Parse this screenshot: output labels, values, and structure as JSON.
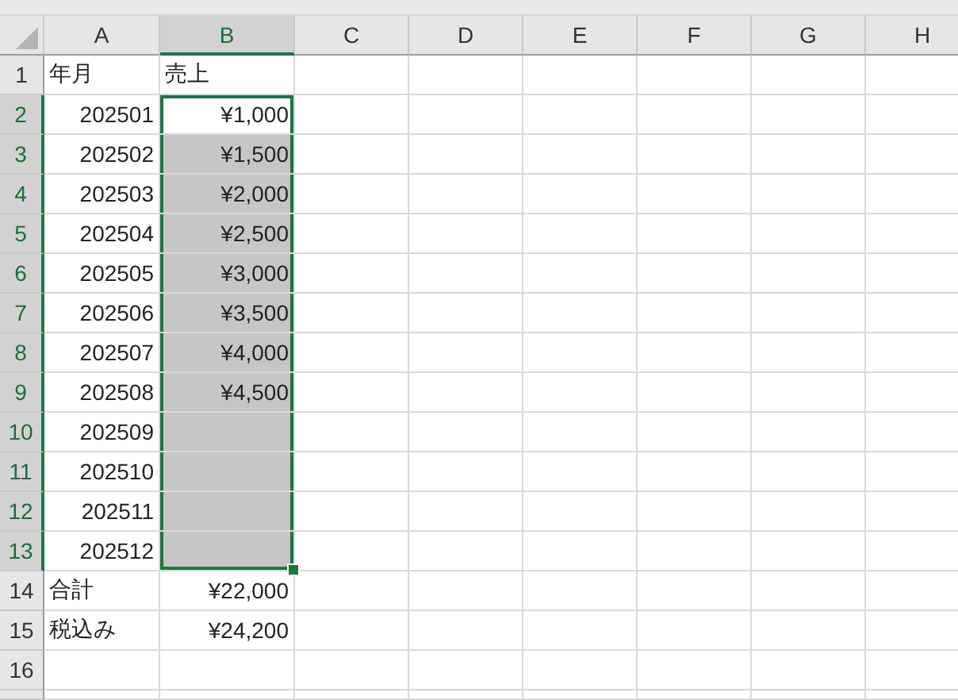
{
  "columns": [
    {
      "label": "A",
      "selected": false
    },
    {
      "label": "B",
      "selected": true
    },
    {
      "label": "C",
      "selected": false
    },
    {
      "label": "D",
      "selected": false
    },
    {
      "label": "E",
      "selected": false
    },
    {
      "label": "F",
      "selected": false
    },
    {
      "label": "G",
      "selected": false
    },
    {
      "label": "H",
      "selected": false
    }
  ],
  "rows": [
    {
      "label": "1",
      "selected": false,
      "cells": [
        {
          "text": "年月",
          "kind": "text",
          "active": false,
          "highlighted": false
        },
        {
          "text": "売上",
          "kind": "text",
          "active": false,
          "highlighted": false
        }
      ]
    },
    {
      "label": "2",
      "selected": true,
      "cells": [
        {
          "text": "202501",
          "kind": "number",
          "active": false,
          "highlighted": false
        },
        {
          "text": "¥1,000",
          "kind": "number",
          "active": true,
          "highlighted": false
        }
      ]
    },
    {
      "label": "3",
      "selected": true,
      "cells": [
        {
          "text": "202502",
          "kind": "number",
          "active": false,
          "highlighted": false
        },
        {
          "text": "¥1,500",
          "kind": "number",
          "active": false,
          "highlighted": true
        }
      ]
    },
    {
      "label": "4",
      "selected": true,
      "cells": [
        {
          "text": "202503",
          "kind": "number",
          "active": false,
          "highlighted": false
        },
        {
          "text": "¥2,000",
          "kind": "number",
          "active": false,
          "highlighted": true
        }
      ]
    },
    {
      "label": "5",
      "selected": true,
      "cells": [
        {
          "text": "202504",
          "kind": "number",
          "active": false,
          "highlighted": false
        },
        {
          "text": "¥2,500",
          "kind": "number",
          "active": false,
          "highlighted": true
        }
      ]
    },
    {
      "label": "6",
      "selected": true,
      "cells": [
        {
          "text": "202505",
          "kind": "number",
          "active": false,
          "highlighted": false
        },
        {
          "text": "¥3,000",
          "kind": "number",
          "active": false,
          "highlighted": true
        }
      ]
    },
    {
      "label": "7",
      "selected": true,
      "cells": [
        {
          "text": "202506",
          "kind": "number",
          "active": false,
          "highlighted": false
        },
        {
          "text": "¥3,500",
          "kind": "number",
          "active": false,
          "highlighted": true
        }
      ]
    },
    {
      "label": "8",
      "selected": true,
      "cells": [
        {
          "text": "202507",
          "kind": "number",
          "active": false,
          "highlighted": false
        },
        {
          "text": "¥4,000",
          "kind": "number",
          "active": false,
          "highlighted": true
        }
      ]
    },
    {
      "label": "9",
      "selected": true,
      "cells": [
        {
          "text": "202508",
          "kind": "number",
          "active": false,
          "highlighted": false
        },
        {
          "text": "¥4,500",
          "kind": "number",
          "active": false,
          "highlighted": true
        }
      ]
    },
    {
      "label": "10",
      "selected": true,
      "cells": [
        {
          "text": "202509",
          "kind": "number",
          "active": false,
          "highlighted": false
        },
        {
          "kind": "number",
          "active": false,
          "highlighted": true
        }
      ]
    },
    {
      "label": "11",
      "selected": true,
      "cells": [
        {
          "text": "202510",
          "kind": "number",
          "active": false,
          "highlighted": false
        },
        {
          "kind": "number",
          "active": false,
          "highlighted": true
        }
      ]
    },
    {
      "label": "12",
      "selected": true,
      "cells": [
        {
          "text": "202511",
          "kind": "number",
          "active": false,
          "highlighted": false
        },
        {
          "kind": "number",
          "active": false,
          "highlighted": true
        }
      ]
    },
    {
      "label": "13",
      "selected": true,
      "cells": [
        {
          "text": "202512",
          "kind": "number",
          "active": false,
          "highlighted": false
        },
        {
          "kind": "number",
          "active": false,
          "highlighted": true
        }
      ]
    },
    {
      "label": "14",
      "selected": false,
      "cells": [
        {
          "text": "合計",
          "kind": "text",
          "active": false,
          "highlighted": false
        },
        {
          "text": "¥22,000",
          "kind": "number",
          "active": false,
          "highlighted": false
        }
      ]
    },
    {
      "label": "15",
      "selected": false,
      "cells": [
        {
          "text": "税込み",
          "kind": "text",
          "active": false,
          "highlighted": false
        },
        {
          "text": "¥24,200",
          "kind": "number",
          "active": false,
          "highlighted": false
        }
      ]
    },
    {
      "label": "16",
      "selected": false,
      "cells": []
    },
    {
      "selected": false,
      "cells": []
    }
  ]
}
